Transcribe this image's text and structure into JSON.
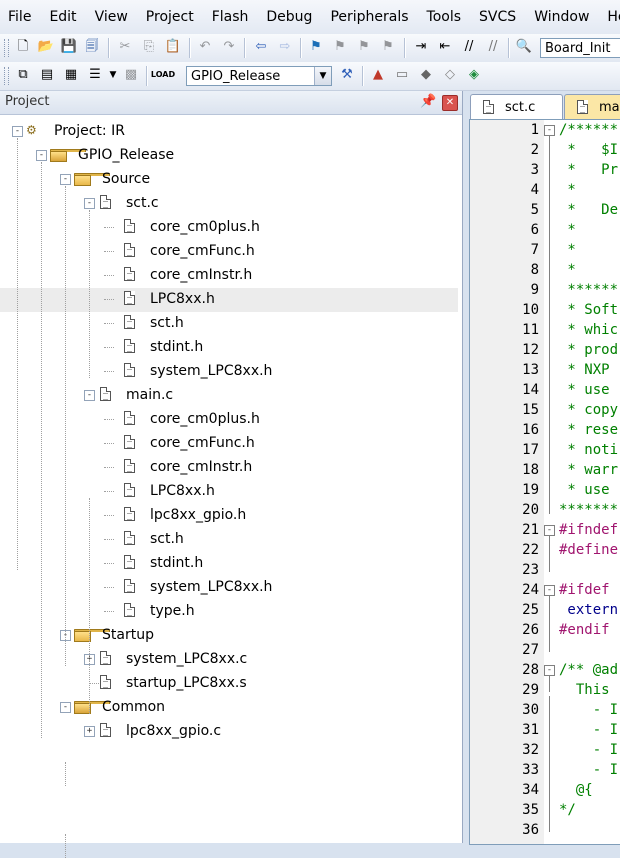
{
  "menu": [
    "File",
    "Edit",
    "View",
    "Project",
    "Flash",
    "Debug",
    "Peripherals",
    "Tools",
    "SVCS",
    "Window",
    "Help"
  ],
  "toolbar1": {
    "icons": [
      "new-file-icon",
      "open-folder-icon",
      "save-icon",
      "save-all-icon",
      "cut-icon",
      "copy-icon",
      "paste-icon",
      "undo-icon",
      "redo-icon",
      "navigate-back-icon",
      "navigate-forward-icon",
      "bookmark-icon",
      "prev-bookmark-icon",
      "next-bookmark-icon",
      "clear-bookmarks-icon",
      "indent-icon",
      "unindent-icon",
      "comment-icon",
      "uncomment-icon",
      "find-in-files-icon"
    ],
    "function_combo": "Board_Init"
  },
  "toolbar2": {
    "icons": [
      "translate-icon",
      "build-icon",
      "rebuild-icon",
      "batch-build-icon",
      "stop-build-icon",
      "download-icon",
      "target-options-icon",
      "manage-components-icon",
      "select-packs-icon",
      "pack-installer-icon",
      "run-time-env-icon"
    ],
    "target_combo": "GPIO_Release"
  },
  "project_panel": {
    "title": "Project",
    "tree": [
      {
        "label": "Project: IR",
        "level": 0,
        "type": "project",
        "expander": "-"
      },
      {
        "label": "GPIO_Release",
        "level": 1,
        "type": "target",
        "expander": "-"
      },
      {
        "label": "Source",
        "level": 2,
        "type": "folder",
        "expander": "-"
      },
      {
        "label": "sct.c",
        "level": 3,
        "type": "file",
        "expander": "-"
      },
      {
        "label": "core_cm0plus.h",
        "level": 4,
        "type": "file"
      },
      {
        "label": "core_cmFunc.h",
        "level": 4,
        "type": "file"
      },
      {
        "label": "core_cmInstr.h",
        "level": 4,
        "type": "file"
      },
      {
        "label": "LPC8xx.h",
        "level": 4,
        "type": "file",
        "highlight": true
      },
      {
        "label": "sct.h",
        "level": 4,
        "type": "file"
      },
      {
        "label": "stdint.h",
        "level": 4,
        "type": "file"
      },
      {
        "label": "system_LPC8xx.h",
        "level": 4,
        "type": "file"
      },
      {
        "label": "main.c",
        "level": 3,
        "type": "file",
        "expander": "-"
      },
      {
        "label": "core_cm0plus.h",
        "level": 4,
        "type": "file"
      },
      {
        "label": "core_cmFunc.h",
        "level": 4,
        "type": "file"
      },
      {
        "label": "core_cmInstr.h",
        "level": 4,
        "type": "file"
      },
      {
        "label": "LPC8xx.h",
        "level": 4,
        "type": "file"
      },
      {
        "label": "lpc8xx_gpio.h",
        "level": 4,
        "type": "file"
      },
      {
        "label": "sct.h",
        "level": 4,
        "type": "file"
      },
      {
        "label": "stdint.h",
        "level": 4,
        "type": "file"
      },
      {
        "label": "system_LPC8xx.h",
        "level": 4,
        "type": "file"
      },
      {
        "label": "type.h",
        "level": 4,
        "type": "file"
      },
      {
        "label": "Startup",
        "level": 2,
        "type": "folder",
        "expander": "-"
      },
      {
        "label": "system_LPC8xx.c",
        "level": 3,
        "type": "file",
        "expander": "+"
      },
      {
        "label": "startup_LPC8xx.s",
        "level": 3,
        "type": "file"
      },
      {
        "label": "Common",
        "level": 2,
        "type": "target",
        "expander": "-"
      },
      {
        "label": "lpc8xx_gpio.c",
        "level": 3,
        "type": "file",
        "expander": "+"
      }
    ]
  },
  "editor": {
    "tabs": [
      "sct.c",
      "ma"
    ],
    "lines": [
      {
        "n": "1",
        "fold": "-",
        "text": "/******",
        "cls": "c-comment"
      },
      {
        "n": "2",
        "text": " *   $I",
        "cls": "c-comment"
      },
      {
        "n": "3",
        "text": " *   Pr",
        "cls": "c-comment"
      },
      {
        "n": "4",
        "text": " *",
        "cls": "c-comment"
      },
      {
        "n": "5",
        "text": " *   De",
        "cls": "c-comment"
      },
      {
        "n": "6",
        "text": " *",
        "cls": "c-comment"
      },
      {
        "n": "7",
        "text": " *",
        "cls": "c-comment"
      },
      {
        "n": "8",
        "text": " *",
        "cls": "c-comment"
      },
      {
        "n": "9",
        "text": " ******",
        "cls": "c-comment"
      },
      {
        "n": "10",
        "text": " * Soft",
        "cls": "c-comment"
      },
      {
        "n": "11",
        "text": " * whic",
        "cls": "c-comment"
      },
      {
        "n": "12",
        "text": " * prod",
        "cls": "c-comment"
      },
      {
        "n": "13",
        "text": " * NXP ",
        "cls": "c-comment"
      },
      {
        "n": "14",
        "text": " * use ",
        "cls": "c-comment"
      },
      {
        "n": "15",
        "text": " * copy",
        "cls": "c-comment"
      },
      {
        "n": "16",
        "text": " * rese",
        "cls": "c-comment"
      },
      {
        "n": "17",
        "text": " * noti",
        "cls": "c-comment"
      },
      {
        "n": "18",
        "text": " * warr",
        "cls": "c-comment"
      },
      {
        "n": "19",
        "text": " * use ",
        "cls": "c-comment"
      },
      {
        "n": "20",
        "text": "*******",
        "cls": "c-comment"
      },
      {
        "n": "21",
        "fold": "-",
        "text": "#ifndef",
        "cls": "c-pre"
      },
      {
        "n": "22",
        "text": "#define",
        "cls": "c-pre"
      },
      {
        "n": "23",
        "text": "",
        "cls": ""
      },
      {
        "n": "24",
        "fold": "-",
        "text": "#ifdef ",
        "cls": "c-pre"
      },
      {
        "n": "25",
        "text": " extern",
        "cls": "c-blue"
      },
      {
        "n": "26",
        "text": "#endif",
        "cls": "c-pre"
      },
      {
        "n": "27",
        "text": "",
        "cls": ""
      },
      {
        "n": "28",
        "fold": "-",
        "text": "/** @ad",
        "cls": "c-comment"
      },
      {
        "n": "29",
        "text": "  This ",
        "cls": "c-comment"
      },
      {
        "n": "30",
        "text": "    - I",
        "cls": "c-comment"
      },
      {
        "n": "31",
        "text": "    - I",
        "cls": "c-comment"
      },
      {
        "n": "32",
        "text": "    - I",
        "cls": "c-comment"
      },
      {
        "n": "33",
        "text": "    - I",
        "cls": "c-comment"
      },
      {
        "n": "34",
        "text": "  @{",
        "cls": "c-comment"
      },
      {
        "n": "35",
        "text": "*/",
        "cls": "c-comment"
      },
      {
        "n": "36",
        "text": "",
        "cls": ""
      }
    ]
  }
}
